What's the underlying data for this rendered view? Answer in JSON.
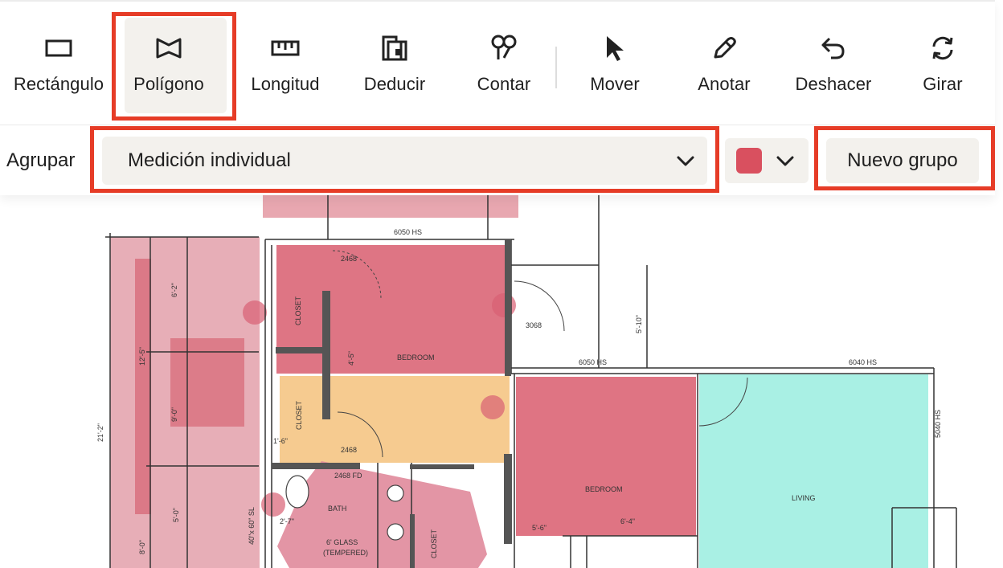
{
  "toolbar": {
    "tools": [
      {
        "label": "Rectángulo",
        "icon": "rectangle-icon"
      },
      {
        "label": "Polígono",
        "icon": "polygon-icon",
        "active": true
      },
      {
        "label": "Longitud",
        "icon": "ruler-icon"
      },
      {
        "label": "Deducir",
        "icon": "deduct-icon"
      },
      {
        "label": "Contar",
        "icon": "count-icon"
      },
      {
        "label": "Mover",
        "icon": "cursor-arrow-icon"
      },
      {
        "label": "Anotar",
        "icon": "pen-icon"
      },
      {
        "label": "Deshacer",
        "icon": "undo-icon"
      },
      {
        "label": "Girar",
        "icon": "rotate-icon"
      }
    ]
  },
  "grouping": {
    "label": "Agrupar",
    "selected": "Medición individual",
    "color": "#d9505f",
    "new_group_label": "Nuevo grupo"
  },
  "plan": {
    "labels": {
      "door_top": "6050 HS",
      "door_3068": "3068",
      "window_mid": "6050 HS",
      "window_right": "6040 HS",
      "window_side": "5040 HS",
      "bedroom1": "BEDROOM",
      "bedroom2": "BEDROOM",
      "closet1": "CLOSET",
      "closet2": "CLOSET",
      "closet3": "CLOSET",
      "bath": "BATH",
      "living": "LIVING",
      "door_2468_a": "2468",
      "door_2468_b": "2468",
      "door_2468_fd": "2468 FD",
      "glass": "6' GLASS",
      "tempered": "(TEMPERED)",
      "dim_21": "21'-2\"",
      "dim_12": "12'-5\"",
      "dim_6": "6'-2\"",
      "dim_9": "9'-0\"",
      "dim_5": "5'-0\"",
      "dim_4": "4'-5\"",
      "dim_5_10": "5'-10\"",
      "dim_8": "8'-0\"",
      "dim_40": "40\"x 60\" SL",
      "dim_2_7": "2'-7\"",
      "dim_1_6": "1'-6\"",
      "dim_5_6": "5'-6\"",
      "dim_6_4": "6'-4\""
    }
  }
}
